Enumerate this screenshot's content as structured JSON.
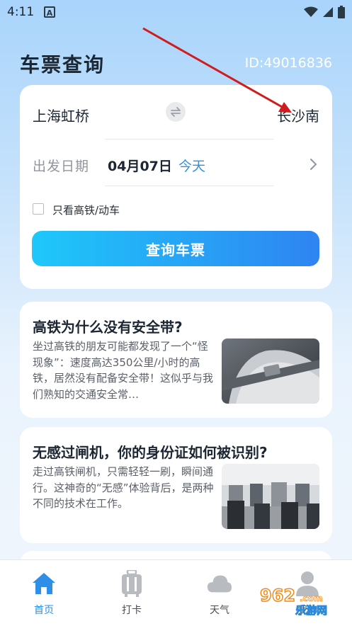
{
  "status_bar": {
    "time": "4:11",
    "notification_letter": "A"
  },
  "header": {
    "title": "车票查询",
    "user_id": "ID:49016836"
  },
  "search": {
    "from_station": "上海虹桥",
    "to_station": "长沙南",
    "date_label": "出发日期",
    "date_value": "04月07日",
    "date_relative": "今天",
    "filter_label": "只看高铁/动车",
    "query_button": "查询车票"
  },
  "articles": [
    {
      "title": "高铁为什么没有安全带?",
      "excerpt": "坐过高铁的朋友可能都发现了一个“怪现象”：速度高达350公里/小时的高铁，居然没有配备安全带！这似乎与我们熟知的交通安全常…"
    },
    {
      "title": "无感过闸机，你的身份证如何被识别?",
      "excerpt": "走过高铁闸机，只需轻轻一刷，瞬间通行。这神奇的“无感”体验背后，是两种不同的技术在工作。"
    }
  ],
  "tabs": [
    {
      "label": "首页",
      "icon": "home-icon",
      "active": true
    },
    {
      "label": "打卡",
      "icon": "luggage-icon",
      "active": false
    },
    {
      "label": "天气",
      "icon": "cloud-icon",
      "active": false
    },
    {
      "label": "我的",
      "icon": "person-icon",
      "active": false
    }
  ],
  "watermark": {
    "text_top": "962",
    "text_bottom": "乐游网"
  },
  "colors": {
    "accent": "#2f8fe8",
    "button_start": "#1ec8fa",
    "button_end": "#2f84f2",
    "arrow": "#d01c1c"
  }
}
